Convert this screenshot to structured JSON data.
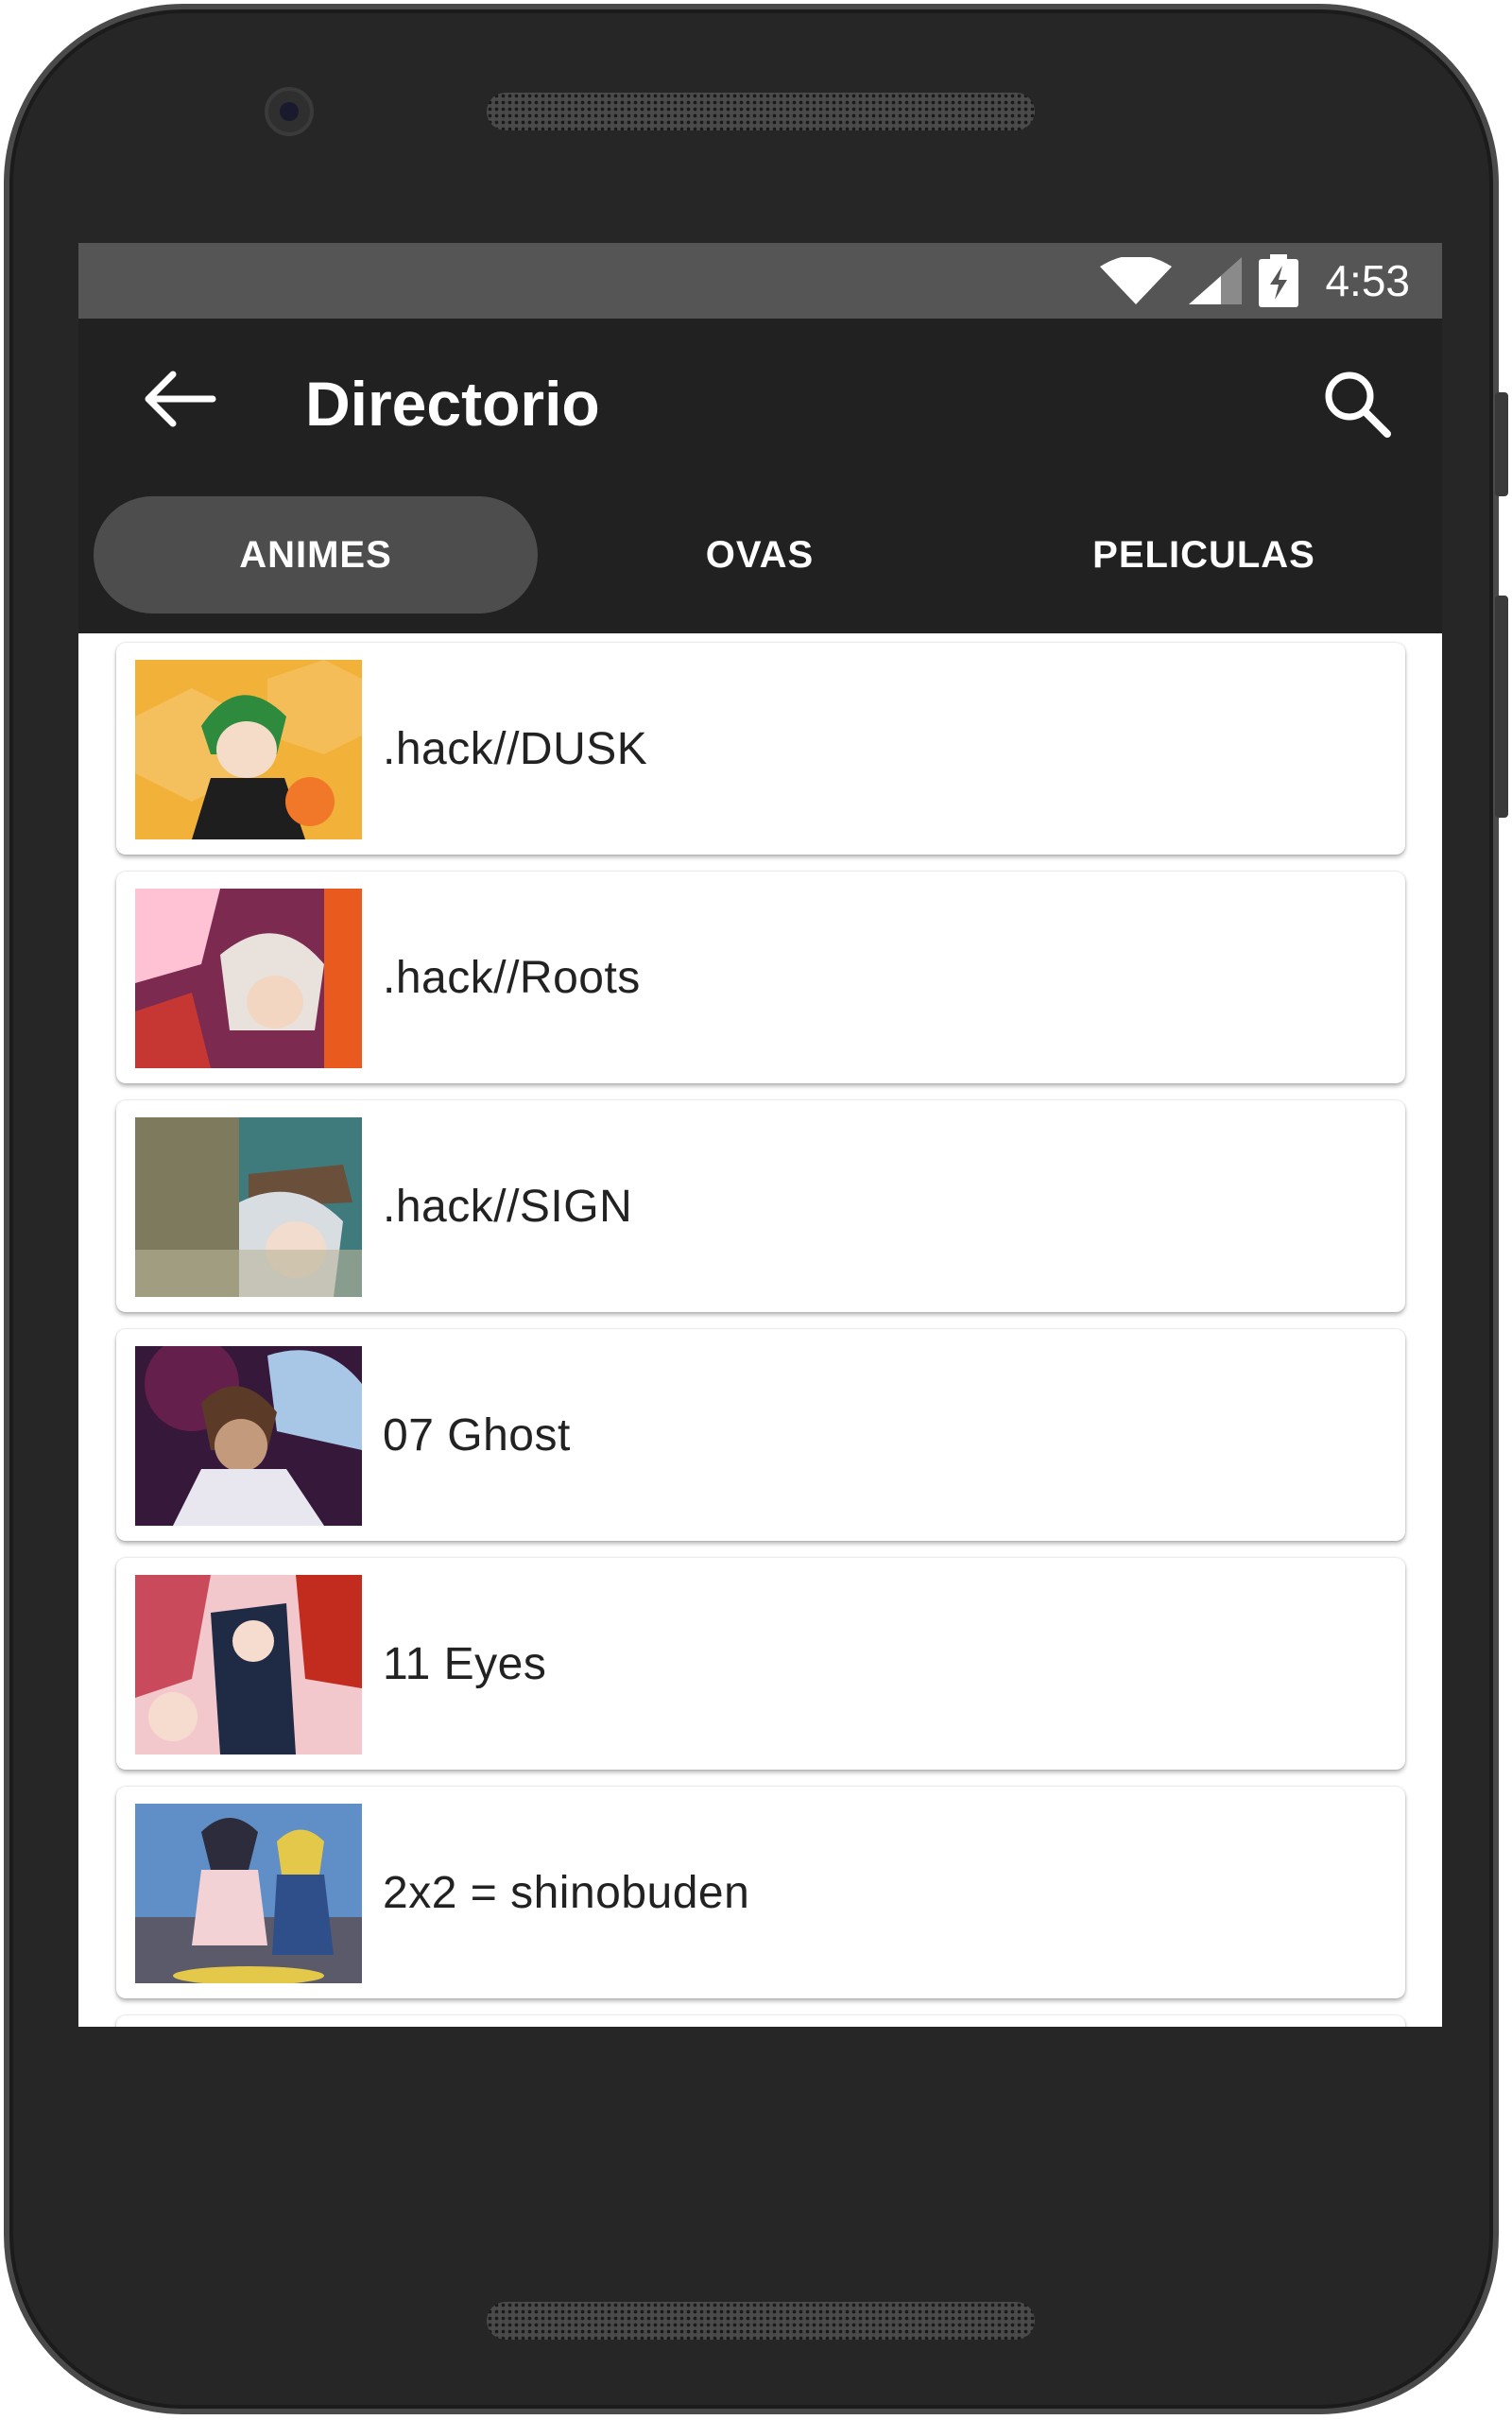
{
  "status_bar": {
    "time": "4:53",
    "icons": [
      "wifi-icon",
      "cell-signal-icon",
      "battery-charging-icon"
    ]
  },
  "app_bar": {
    "title": "Directorio",
    "back_icon": "arrow-back-icon",
    "search_icon": "search-icon"
  },
  "tabs": [
    {
      "label": "ANIMES",
      "active": true
    },
    {
      "label": "OVAS",
      "active": false
    },
    {
      "label": "PELICULAS",
      "active": false
    }
  ],
  "items": [
    {
      "title": ".hack//DUSK",
      "thumb_colors": [
        "#f2b23a",
        "#2e8a3c",
        "#1e1e1e",
        "#f07828"
      ]
    },
    {
      "title": ".hack//Roots",
      "thumb_colors": [
        "#7c2a4f",
        "#ffc2d4",
        "#e9e2dc",
        "#e85a1d"
      ]
    },
    {
      "title": ".hack//SIGN",
      "thumb_colors": [
        "#3f7a7c",
        "#b9b49a",
        "#d8dde2",
        "#6a4f3a"
      ]
    },
    {
      "title": "07 Ghost",
      "thumb_colors": [
        "#35183a",
        "#c49a7c",
        "#e8e6ee",
        "#5b3a28"
      ]
    },
    {
      "title": "11 Eyes",
      "thumb_colors": [
        "#c94a5a",
        "#f3c8cc",
        "#1f2a44",
        "#c22c1f"
      ]
    },
    {
      "title": "2x2 = shinobuden",
      "thumb_colors": [
        "#5f8fc6",
        "#f3d2d6",
        "#2c2c3c",
        "#e4c84a"
      ]
    }
  ],
  "nav_bar": {
    "icons": [
      "nav-back-icon",
      "nav-home-icon",
      "nav-recents-icon"
    ]
  },
  "colors": {
    "app_bar": "#212121",
    "status_bar": "#555555",
    "active_tab": "#4d4d4d"
  }
}
